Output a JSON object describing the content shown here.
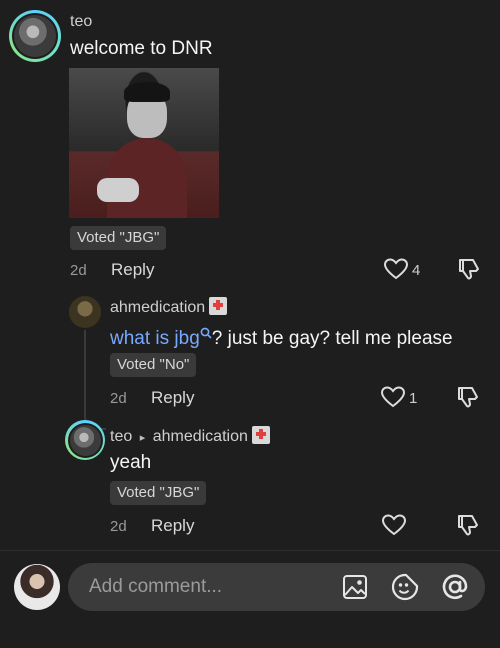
{
  "post": {
    "username": "teo",
    "message": "welcome to DNR",
    "voted": "Voted \"JBG\"",
    "time": "2d",
    "reply_label": "Reply",
    "like_count": "4"
  },
  "reply1": {
    "username": "ahmedication",
    "link_text": "what is jbg",
    "message_rest": "? just be gay? tell me please",
    "voted": "Voted \"No\"",
    "time": "2d",
    "reply_label": "Reply",
    "like_count": "1"
  },
  "reply2": {
    "username": "teo",
    "arrow": "▸",
    "reply_to": "ahmedication",
    "message": "yeah",
    "voted": "Voted \"JBG\"",
    "time": "2d",
    "reply_label": "Reply"
  },
  "composer": {
    "placeholder": "Add comment..."
  },
  "icons": {
    "like": "heart-icon",
    "dislike": "thumbs-down-icon",
    "image": "image-icon",
    "sticker": "sticker-icon",
    "mention": "at-sign-icon",
    "search": "search-icon"
  },
  "colors": {
    "background": "#1e1e1e",
    "link": "#76a9ff",
    "input_bg": "#3b3b3b"
  }
}
